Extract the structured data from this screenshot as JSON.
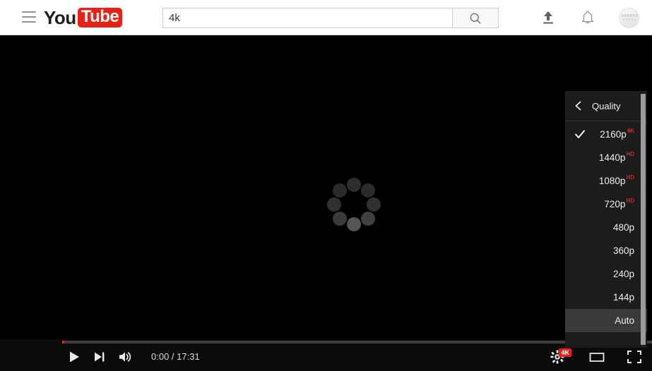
{
  "header": {
    "menu_icon": "hamburger-icon",
    "logo_you": "You",
    "logo_tube": "Tube",
    "search": {
      "value": "4k",
      "placeholder": "Search",
      "button_icon": "search-icon"
    },
    "upload_icon": "upload-icon",
    "notifications_icon": "bell-icon",
    "avatar_label": "account-avatar"
  },
  "player": {
    "state_icon": "loading-spinner",
    "progress_percent": 0,
    "controls": {
      "play_label": "Play",
      "next_label": "Next",
      "volume_label": "Mute",
      "time": "0:00 / 17:31",
      "current_time": "0:00",
      "duration": "17:31",
      "settings_label": "Settings",
      "settings_badge": "4K",
      "theater_label": "Theater mode",
      "fullscreen_label": "Full screen"
    }
  },
  "quality_menu": {
    "title": "Quality",
    "back_icon": "chevron-left-icon",
    "selected": "2160p",
    "hovered": "Auto",
    "items": [
      {
        "label": "2160p",
        "badge": "4K",
        "selected": true,
        "hovered": false
      },
      {
        "label": "1440p",
        "badge": "HD",
        "selected": false,
        "hovered": false
      },
      {
        "label": "1080p",
        "badge": "HD",
        "selected": false,
        "hovered": false
      },
      {
        "label": "720p",
        "badge": "HD",
        "selected": false,
        "hovered": false
      },
      {
        "label": "480p",
        "badge": "",
        "selected": false,
        "hovered": false
      },
      {
        "label": "360p",
        "badge": "",
        "selected": false,
        "hovered": false
      },
      {
        "label": "240p",
        "badge": "",
        "selected": false,
        "hovered": false
      },
      {
        "label": "144p",
        "badge": "",
        "selected": false,
        "hovered": false
      },
      {
        "label": "Auto",
        "badge": "",
        "selected": false,
        "hovered": true
      }
    ]
  },
  "colors": {
    "brand_red": "#e62117",
    "header_bg": "#ffffff",
    "video_bg": "#000000",
    "menu_bg": "#1c1c1c",
    "menu_hover": "#3a3a3a",
    "badge_red": "#e62117"
  }
}
